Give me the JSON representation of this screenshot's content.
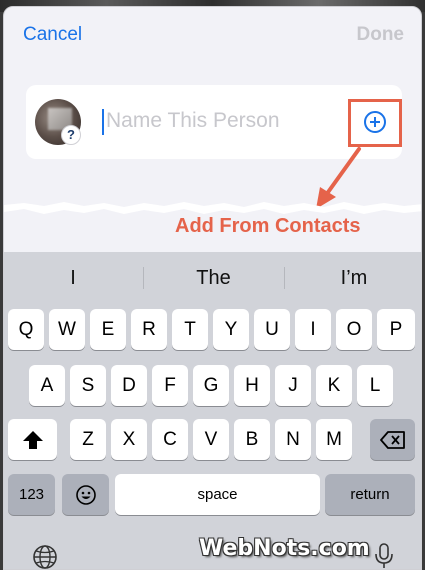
{
  "nav": {
    "cancel_label": "Cancel",
    "done_label": "Done"
  },
  "name_field": {
    "placeholder": "Name This Person",
    "value": ""
  },
  "avatar": {
    "badge": "?"
  },
  "add_contact": {
    "icon": "plus-circle-icon"
  },
  "annotation": {
    "label": "Add From Contacts",
    "color": "#e5634a"
  },
  "keyboard": {
    "suggestions": [
      "I",
      "The",
      "I’m"
    ],
    "row1": [
      "Q",
      "W",
      "E",
      "R",
      "T",
      "Y",
      "U",
      "I",
      "O",
      "P"
    ],
    "row2": [
      "A",
      "S",
      "D",
      "F",
      "G",
      "H",
      "J",
      "K",
      "L"
    ],
    "row3": [
      "Z",
      "X",
      "C",
      "V",
      "B",
      "N",
      "M"
    ],
    "numbers_label": "123",
    "space_label": "space",
    "return_label": "return",
    "shift_icon": "shift-icon",
    "delete_icon": "delete-icon",
    "emoji_icon": "emoji-icon",
    "globe_icon": "globe-icon",
    "mic_icon": "microphone-icon"
  },
  "watermark": {
    "text": "WebNots.com"
  }
}
